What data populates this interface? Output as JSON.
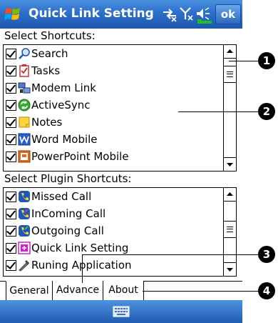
{
  "titlebar": {
    "title": "Quick Link Setting",
    "ok_label": "ok"
  },
  "shortcuts": {
    "label": "Select Shortcuts:",
    "items": [
      {
        "label": "Search",
        "icon": "search-icon"
      },
      {
        "label": "Tasks",
        "icon": "tasks-icon"
      },
      {
        "label": "Modem Link",
        "icon": "modem-link-icon"
      },
      {
        "label": "ActiveSync",
        "icon": "activesync-icon"
      },
      {
        "label": "Notes",
        "icon": "notes-icon"
      },
      {
        "label": "Word Mobile",
        "icon": "word-mobile-icon"
      },
      {
        "label": "PowerPoint Mobile",
        "icon": "powerpoint-mobile-icon"
      }
    ]
  },
  "plugins": {
    "label": "Select Plugin Shortcuts:",
    "items": [
      {
        "label": "Missed Call",
        "icon": "missed-call-icon"
      },
      {
        "label": "InComing Call",
        "icon": "incoming-call-icon"
      },
      {
        "label": "Outgoing Call",
        "icon": "outgoing-call-icon"
      },
      {
        "label": "Quick Link Setting",
        "icon": "quick-link-setting-icon"
      },
      {
        "label": "Runing Application",
        "icon": "running-application-icon"
      }
    ]
  },
  "tabs": [
    {
      "label": "General",
      "active": true
    },
    {
      "label": "Advance",
      "active": false
    },
    {
      "label": "About",
      "active": false
    }
  ],
  "callouts": [
    "1",
    "2",
    "3",
    "4"
  ],
  "colors": {
    "titlebar": "#2d6fc9",
    "bottombar": "#1f5bb0"
  }
}
